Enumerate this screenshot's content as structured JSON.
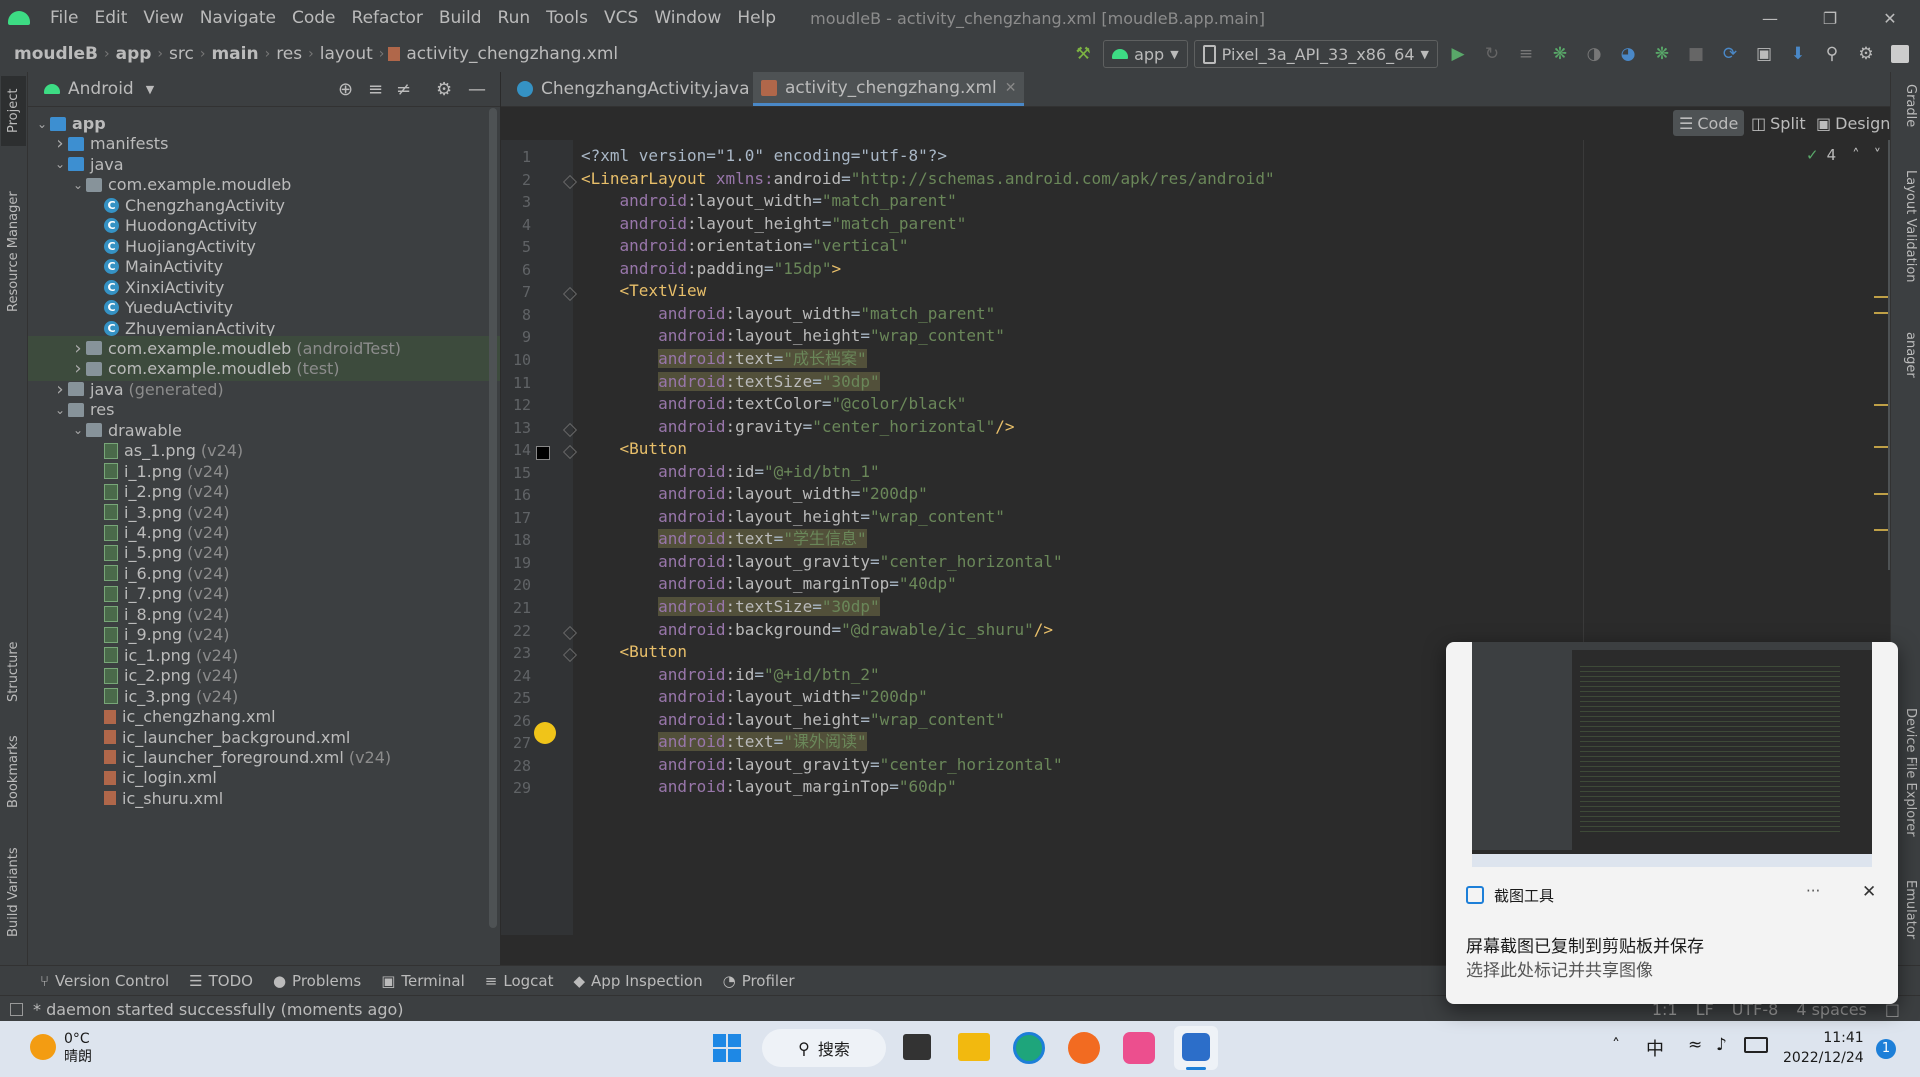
{
  "menubar": {
    "items": [
      "File",
      "Edit",
      "View",
      "Navigate",
      "Code",
      "Refactor",
      "Build",
      "Run",
      "Tools",
      "VCS",
      "Window",
      "Help"
    ],
    "window_title": "moudleB - activity_chengzhang.xml [moudleB.app.main]"
  },
  "navbar": {
    "crumbs": [
      "moudleB",
      "app",
      "src",
      "main",
      "res",
      "layout",
      "activity_chengzhang.xml"
    ],
    "run_config": "app",
    "device": "Pixel_3a_API_33_x86_64"
  },
  "left_stripe": [
    "Project",
    "Resource Manager",
    "Structure",
    "Bookmarks",
    "Build Variants"
  ],
  "project": {
    "view": "Android",
    "tree": [
      {
        "label": "app",
        "extra": "",
        "type": "app",
        "indent": 0,
        "arrow": "down",
        "bold": true
      },
      {
        "label": "manifests",
        "extra": "",
        "type": "folder-blue",
        "indent": 1,
        "arrow": "right"
      },
      {
        "label": "java",
        "extra": "",
        "type": "folder-blue",
        "indent": 1,
        "arrow": "down"
      },
      {
        "label": "com.example.moudleb",
        "extra": "",
        "type": "pkg",
        "indent": 2,
        "arrow": "down"
      },
      {
        "label": "ChengzhangActivity",
        "extra": "",
        "type": "class",
        "indent": 3,
        "arrow": ""
      },
      {
        "label": "HuodongActivity",
        "extra": "",
        "type": "class",
        "indent": 3,
        "arrow": ""
      },
      {
        "label": "HuojiangActivity",
        "extra": "",
        "type": "class",
        "indent": 3,
        "arrow": ""
      },
      {
        "label": "MainActivity",
        "extra": "",
        "type": "class",
        "indent": 3,
        "arrow": ""
      },
      {
        "label": "XinxiActivity",
        "extra": "",
        "type": "class",
        "indent": 3,
        "arrow": ""
      },
      {
        "label": "YueduActivity",
        "extra": "",
        "type": "class",
        "indent": 3,
        "arrow": ""
      },
      {
        "label": "ZhuyemianActivity",
        "extra": "",
        "type": "class",
        "indent": 3,
        "arrow": ""
      },
      {
        "label": "com.example.moudleb",
        "extra": "(androidTest)",
        "type": "pkg",
        "indent": 2,
        "arrow": "right",
        "sel": true
      },
      {
        "label": "com.example.moudleb",
        "extra": "(test)",
        "type": "pkg",
        "indent": 2,
        "arrow": "right",
        "sel": true
      },
      {
        "label": "java",
        "extra": "(generated)",
        "type": "folder",
        "indent": 1,
        "arrow": "right"
      },
      {
        "label": "res",
        "extra": "",
        "type": "folder",
        "indent": 1,
        "arrow": "down"
      },
      {
        "label": "drawable",
        "extra": "",
        "type": "folder",
        "indent": 2,
        "arrow": "down"
      },
      {
        "label": "as_1.png",
        "extra": "(v24)",
        "type": "png",
        "indent": 3,
        "arrow": ""
      },
      {
        "label": "i_1.png",
        "extra": "(v24)",
        "type": "png",
        "indent": 3,
        "arrow": ""
      },
      {
        "label": "i_2.png",
        "extra": "(v24)",
        "type": "png",
        "indent": 3,
        "arrow": ""
      },
      {
        "label": "i_3.png",
        "extra": "(v24)",
        "type": "png",
        "indent": 3,
        "arrow": ""
      },
      {
        "label": "i_4.png",
        "extra": "(v24)",
        "type": "png",
        "indent": 3,
        "arrow": ""
      },
      {
        "label": "i_5.png",
        "extra": "(v24)",
        "type": "png",
        "indent": 3,
        "arrow": ""
      },
      {
        "label": "i_6.png",
        "extra": "(v24)",
        "type": "png",
        "indent": 3,
        "arrow": ""
      },
      {
        "label": "i_7.png",
        "extra": "(v24)",
        "type": "png",
        "indent": 3,
        "arrow": ""
      },
      {
        "label": "i_8.png",
        "extra": "(v24)",
        "type": "png",
        "indent": 3,
        "arrow": ""
      },
      {
        "label": "i_9.png",
        "extra": "(v24)",
        "type": "png",
        "indent": 3,
        "arrow": ""
      },
      {
        "label": "ic_1.png",
        "extra": "(v24)",
        "type": "png",
        "indent": 3,
        "arrow": ""
      },
      {
        "label": "ic_2.png",
        "extra": "(v24)",
        "type": "png",
        "indent": 3,
        "arrow": ""
      },
      {
        "label": "ic_3.png",
        "extra": "(v24)",
        "type": "png",
        "indent": 3,
        "arrow": ""
      },
      {
        "label": "ic_chengzhang.xml",
        "extra": "",
        "type": "xml",
        "indent": 3,
        "arrow": ""
      },
      {
        "label": "ic_launcher_background.xml",
        "extra": "",
        "type": "xml",
        "indent": 3,
        "arrow": ""
      },
      {
        "label": "ic_launcher_foreground.xml",
        "extra": "(v24)",
        "type": "xml",
        "indent": 3,
        "arrow": ""
      },
      {
        "label": "ic_login.xml",
        "extra": "",
        "type": "xml",
        "indent": 3,
        "arrow": ""
      },
      {
        "label": "ic_shuru.xml",
        "extra": "",
        "type": "xml",
        "indent": 3,
        "arrow": ""
      }
    ]
  },
  "editor": {
    "tabs": [
      {
        "label": "ChengzhangActivity.java",
        "kind": "java",
        "active": false
      },
      {
        "label": "activity_chengzhang.xml",
        "kind": "xml",
        "active": true
      }
    ],
    "view_modes": [
      "Code",
      "Split",
      "Design"
    ],
    "inspection": "4",
    "lines": [
      [
        [
          "",
          "<?xml version=\"1.0\" encoding=\"utf-8\"?>"
        ]
      ],
      [
        [
          "tag",
          "<LinearLayout "
        ],
        [
          "ns",
          "xmlns:"
        ],
        [
          "attr",
          "android"
        ],
        [
          "",
          "="
        ],
        [
          "val",
          "\"http://schemas.android.com/apk/res/android\""
        ]
      ],
      [
        [
          "",
          "    "
        ],
        [
          "ns",
          "android"
        ],
        [
          "attr",
          ":layout_width"
        ],
        [
          "",
          "="
        ],
        [
          "val",
          "\"match_parent\""
        ]
      ],
      [
        [
          "",
          "    "
        ],
        [
          "ns",
          "android"
        ],
        [
          "attr",
          ":layout_height"
        ],
        [
          "",
          "="
        ],
        [
          "val",
          "\"match_parent\""
        ]
      ],
      [
        [
          "",
          "    "
        ],
        [
          "ns",
          "android"
        ],
        [
          "attr",
          ":orientation"
        ],
        [
          "",
          "="
        ],
        [
          "val",
          "\"vertical\""
        ]
      ],
      [
        [
          "",
          "    "
        ],
        [
          "ns",
          "android"
        ],
        [
          "attr",
          ":padding"
        ],
        [
          "",
          "="
        ],
        [
          "val",
          "\"15dp\""
        ],
        [
          "tag",
          ">"
        ]
      ],
      [
        [
          "",
          "    "
        ],
        [
          "tag",
          "<TextView"
        ]
      ],
      [
        [
          "",
          "        "
        ],
        [
          "ns",
          "android"
        ],
        [
          "attr",
          ":layout_width"
        ],
        [
          "",
          "="
        ],
        [
          "val",
          "\"match_parent\""
        ]
      ],
      [
        [
          "",
          "        "
        ],
        [
          "ns",
          "android"
        ],
        [
          "attr",
          ":layout_height"
        ],
        [
          "",
          "="
        ],
        [
          "val",
          "\"wrap_content\""
        ]
      ],
      [
        [
          "",
          "        "
        ],
        [
          "hl ns",
          "android"
        ],
        [
          "hl attr",
          ":text"
        ],
        [
          "hl",
          "="
        ],
        [
          "hl val",
          "\"成长档案\""
        ]
      ],
      [
        [
          "",
          "        "
        ],
        [
          "hl ns",
          "android"
        ],
        [
          "hl attr",
          ":textSize"
        ],
        [
          "hl",
          "="
        ],
        [
          "hl val",
          "\"30dp\""
        ]
      ],
      [
        [
          "",
          "        "
        ],
        [
          "ns",
          "android"
        ],
        [
          "attr",
          ":textColor"
        ],
        [
          "",
          "="
        ],
        [
          "val",
          "\"@color/black\""
        ]
      ],
      [
        [
          "",
          "        "
        ],
        [
          "ns",
          "android"
        ],
        [
          "attr",
          ":gravity"
        ],
        [
          "",
          "="
        ],
        [
          "val",
          "\"center_horizontal\""
        ],
        [
          "tag",
          "/>"
        ]
      ],
      [
        [
          "",
          "    "
        ],
        [
          "tag",
          "<Button"
        ]
      ],
      [
        [
          "",
          "        "
        ],
        [
          "ns",
          "android"
        ],
        [
          "attr",
          ":id"
        ],
        [
          "",
          "="
        ],
        [
          "val",
          "\"@+id/btn_1\""
        ]
      ],
      [
        [
          "",
          "        "
        ],
        [
          "ns",
          "android"
        ],
        [
          "attr",
          ":layout_width"
        ],
        [
          "",
          "="
        ],
        [
          "val",
          "\"200dp\""
        ]
      ],
      [
        [
          "",
          "        "
        ],
        [
          "ns",
          "android"
        ],
        [
          "attr",
          ":layout_height"
        ],
        [
          "",
          "="
        ],
        [
          "val",
          "\"wrap_content\""
        ]
      ],
      [
        [
          "",
          "        "
        ],
        [
          "hl ns",
          "android"
        ],
        [
          "hl attr",
          ":text"
        ],
        [
          "hl",
          "="
        ],
        [
          "hl val",
          "\"学生信息\""
        ]
      ],
      [
        [
          "",
          "        "
        ],
        [
          "ns",
          "android"
        ],
        [
          "attr",
          ":layout_gravity"
        ],
        [
          "",
          "="
        ],
        [
          "val",
          "\"center_horizontal\""
        ]
      ],
      [
        [
          "",
          "        "
        ],
        [
          "ns",
          "android"
        ],
        [
          "attr",
          ":layout_marginTop"
        ],
        [
          "",
          "="
        ],
        [
          "val",
          "\"40dp\""
        ]
      ],
      [
        [
          "",
          "        "
        ],
        [
          "hl ns",
          "android"
        ],
        [
          "hl attr",
          ":textSize"
        ],
        [
          "hl",
          "="
        ],
        [
          "hl val",
          "\"30dp\""
        ]
      ],
      [
        [
          "",
          "        "
        ],
        [
          "ns",
          "android"
        ],
        [
          "attr",
          ":background"
        ],
        [
          "",
          "="
        ],
        [
          "val",
          "\"@drawable/ic_shuru\""
        ],
        [
          "tag",
          "/>"
        ]
      ],
      [
        [
          "",
          "    "
        ],
        [
          "tag",
          "<Button"
        ]
      ],
      [
        [
          "",
          "        "
        ],
        [
          "ns",
          "android"
        ],
        [
          "attr",
          ":id"
        ],
        [
          "",
          "="
        ],
        [
          "val",
          "\"@+id/btn_2\""
        ]
      ],
      [
        [
          "",
          "        "
        ],
        [
          "ns",
          "android"
        ],
        [
          "attr",
          ":layout_width"
        ],
        [
          "",
          "="
        ],
        [
          "val",
          "\"200dp\""
        ]
      ],
      [
        [
          "",
          "        "
        ],
        [
          "ns",
          "android"
        ],
        [
          "attr",
          ":layout_height"
        ],
        [
          "",
          "="
        ],
        [
          "val",
          "\"wrap_content\""
        ]
      ],
      [
        [
          "",
          "        "
        ],
        [
          "hl ns",
          "android"
        ],
        [
          "hl attr",
          ":text"
        ],
        [
          "hl",
          "="
        ],
        [
          "hl val",
          "\"课外阅读\""
        ]
      ],
      [
        [
          "",
          "        "
        ],
        [
          "ns",
          "android"
        ],
        [
          "attr",
          ":layout_gravity"
        ],
        [
          "",
          "="
        ],
        [
          "val",
          "\"center_horizontal\""
        ]
      ],
      [
        [
          "",
          "        "
        ],
        [
          "ns",
          "android"
        ],
        [
          "attr",
          ":layout_marginTop"
        ],
        [
          "",
          "="
        ],
        [
          "val",
          "\"60dp\""
        ]
      ]
    ]
  },
  "right_stripe": [
    "Gradle",
    "Layout Validation",
    "anager",
    "Device File Explorer",
    "Emulator"
  ],
  "bottom_tools": [
    "Version Control",
    "TODO",
    "Problems",
    "Terminal",
    "Logcat",
    "App Inspection",
    "Profiler"
  ],
  "status": {
    "message": "* daemon started successfully (moments ago)",
    "position": "1:1",
    "line_sep": "LF",
    "encoding": "UTF-8",
    "indent": "4 spaces"
  },
  "toast": {
    "app": "截图工具",
    "more": "···",
    "title": "屏幕截图已复制到剪贴板并保存",
    "body": "选择此处标记并共享图像"
  },
  "taskbar": {
    "temp": "0°C",
    "weather": "晴朗",
    "search": "搜索",
    "ime": "中",
    "time": "11:41",
    "date": "2022/12/24",
    "badge": "1"
  },
  "colors": {
    "accent": "#4a88c7",
    "android_green": "#3ddc84"
  }
}
